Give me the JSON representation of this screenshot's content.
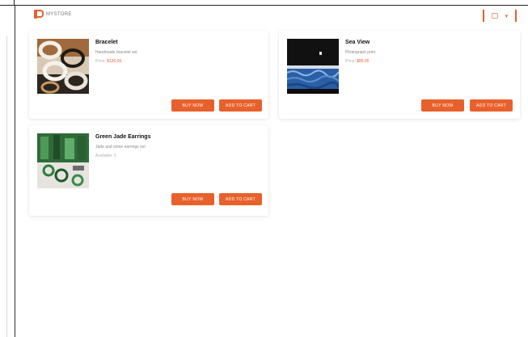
{
  "app": {
    "brand_name": "MYSTORE"
  },
  "colors": {
    "accent": "#e8612c"
  },
  "header": {
    "user_menu_chevron": "▾"
  },
  "products": [
    {
      "title": "Bracelet",
      "subtitle": "Handmade bracelet set",
      "price_label": "Price:",
      "price_value": "$120.00",
      "buy_label": "BUY NOW",
      "cart_label": "ADD TO CART"
    },
    {
      "title": "Sea View",
      "subtitle": "Photograph print",
      "price_label": "Price:",
      "price_value": "$85.00",
      "buy_label": "BUY NOW",
      "cart_label": "ADD TO CART"
    },
    {
      "title": "Green Jade Earrings",
      "subtitle": "Jade and stone earrings set",
      "price_label": "Available: 5",
      "price_value": "",
      "buy_label": "BUY NOW",
      "cart_label": "ADD TO CART"
    }
  ]
}
